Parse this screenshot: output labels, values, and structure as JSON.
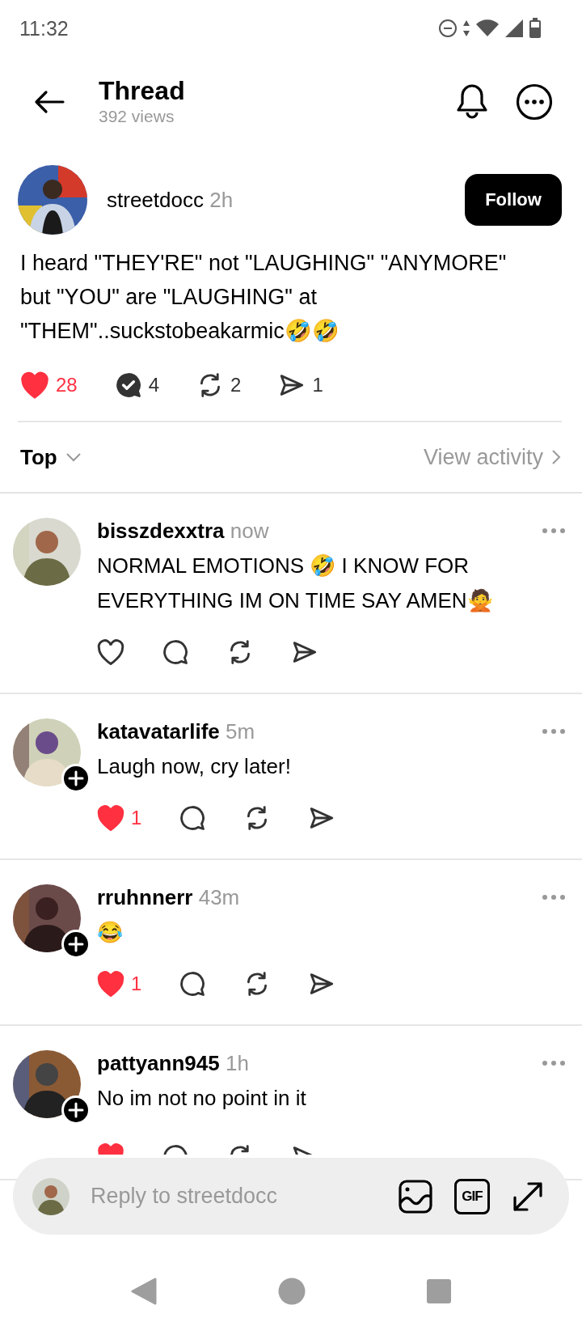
{
  "status_bar": {
    "time": "11:32"
  },
  "header": {
    "title": "Thread",
    "views": "392 views"
  },
  "post": {
    "author": "streetdocc",
    "time": "2h",
    "follow_label": "Follow",
    "text": "I heard \"THEY'RE\" not \"LAUGHING\" \"ANYMORE\" but \"YOU\" are \"LAUGHING\" at \"THEM\"..suckstobeakarmic🤣🤣",
    "stats": {
      "liked": true,
      "likes": "28",
      "replied": true,
      "replies": "4",
      "reposts": "2",
      "shares": "1"
    }
  },
  "sort": {
    "label": "Top",
    "link": "View activity"
  },
  "comments": [
    {
      "user": "bisszdexxtra",
      "time": "now",
      "text": "NORMAL EMOTIONS 🤣 I KNOW FOR EVERYTHING IM ON TIME SAY AMEN🙅",
      "follow_badge": false,
      "liked": false
    },
    {
      "user": "katavatarlife",
      "time": "5m",
      "text": "Laugh now, cry later!",
      "follow_badge": true,
      "liked": true,
      "likes": "1"
    },
    {
      "user": "rruhnnerr",
      "time": "43m",
      "text": "😂",
      "follow_badge": true,
      "liked": true,
      "likes": "1"
    },
    {
      "user": "pattyann945",
      "time": "1h",
      "text": "No im not no point in it",
      "follow_badge": true,
      "liked": true
    }
  ],
  "reply_bar": {
    "placeholder": "Reply to streetdocc",
    "gif_label": "GIF"
  }
}
